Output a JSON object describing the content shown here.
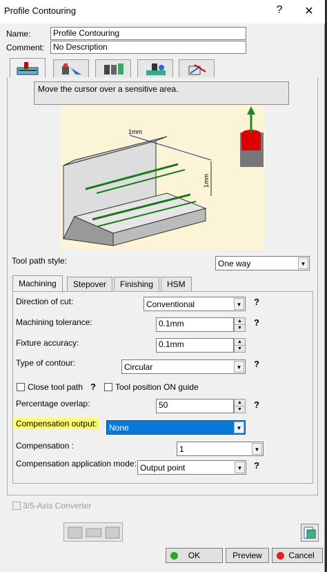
{
  "window": {
    "title": "Profile Contouring",
    "help": "?",
    "close": "✕"
  },
  "fields": {
    "name_label": "Name:",
    "name_value": "Profile Contouring",
    "comment_label": "Comment:",
    "comment_value": "No Description"
  },
  "hint": "Move the cursor over a sensitive area.",
  "diagram": {
    "dim1": "1mm",
    "dim2": "1mm"
  },
  "tool_path_style": {
    "label": "Tool path style:",
    "value": "One way"
  },
  "tabs": [
    "Machining",
    "Stepover",
    "Finishing",
    "HSM"
  ],
  "machining": {
    "direction_label": "Direction of cut:",
    "direction_value": "Conventional",
    "tolerance_label": "Machining tolerance:",
    "tolerance_value": "0.1mm",
    "fixture_label": "Fixture accuracy:",
    "fixture_value": "0.1mm",
    "contour_label": "Type of contour:",
    "contour_value": "Circular",
    "close_tool_path": "Close tool path",
    "tool_position": "Tool position ON guide",
    "overlap_label": "Percentage overlap:",
    "overlap_value": "50",
    "comp_output_label": "Compensation output:",
    "comp_output_value": "None",
    "compensation_label": "Compensation :",
    "compensation_value": "1",
    "comp_mode_label": "Compensation application mode:",
    "comp_mode_value": "Output point"
  },
  "converter": "3/5-Axis Converter",
  "buttons": {
    "ok": "OK",
    "preview": "Preview",
    "cancel": "Cancel"
  },
  "q": "?"
}
